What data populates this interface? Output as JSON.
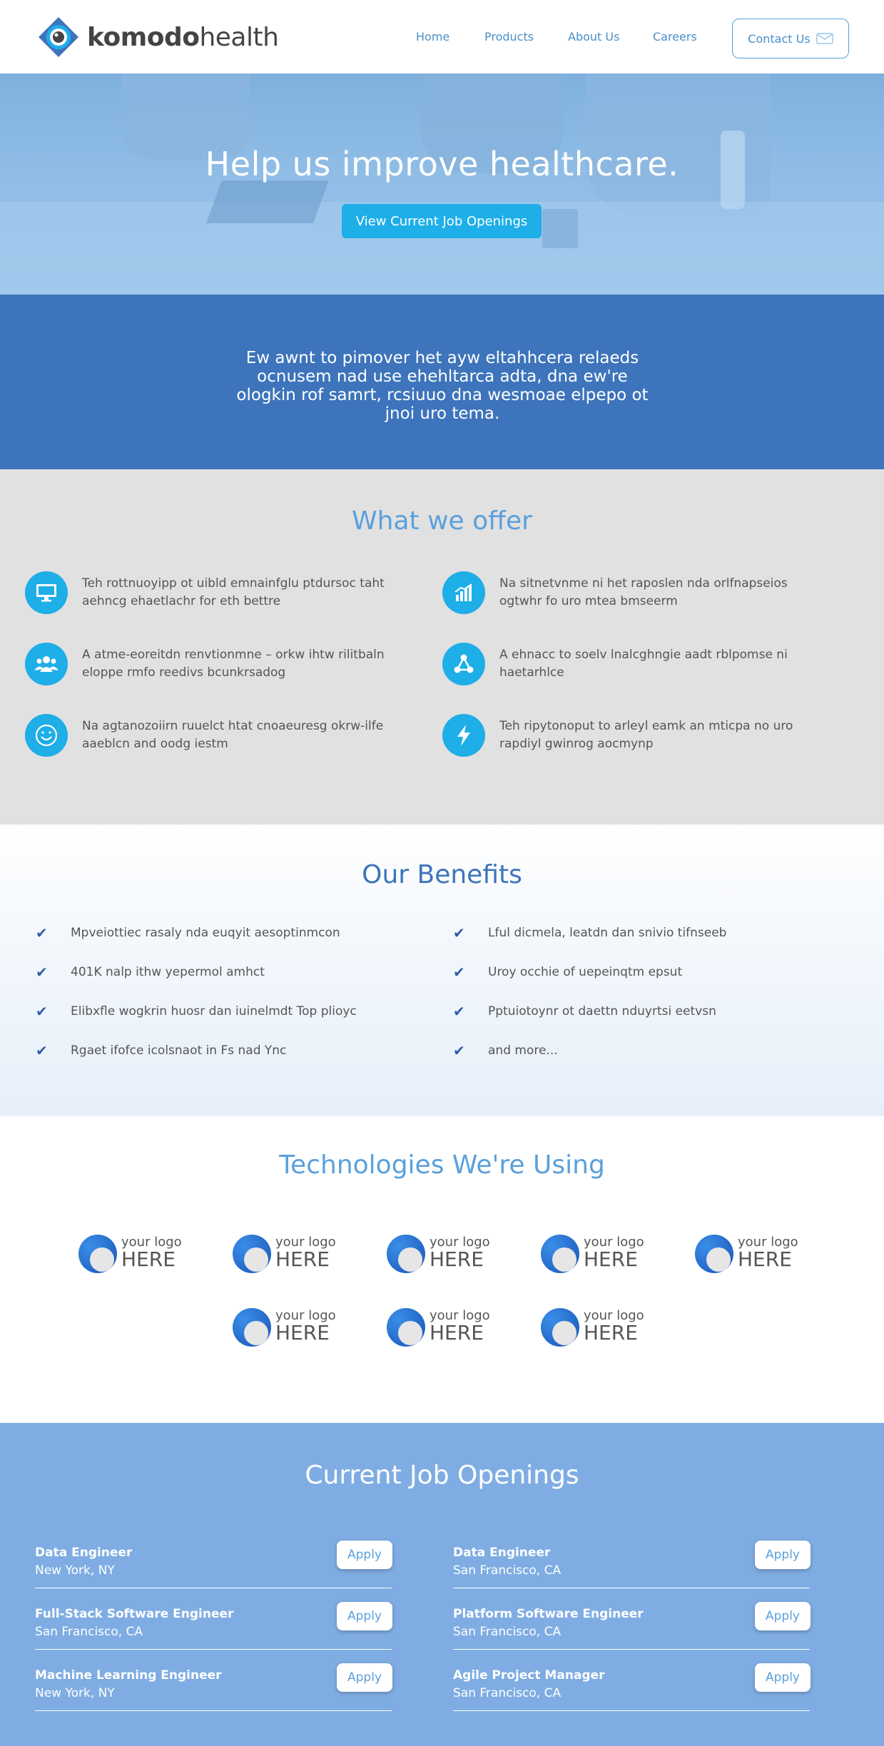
{
  "header": {
    "logo": {
      "bold": "komodo",
      "light": "health"
    },
    "nav": [
      {
        "label": "Home"
      },
      {
        "label": "Products"
      },
      {
        "label": "About Us"
      },
      {
        "label": "Careers"
      }
    ],
    "contact_label": "Contact Us",
    "contact_icon": "mail-icon"
  },
  "hero": {
    "title": "Help us improve healthcare.",
    "button_label": "View Current Job Openings"
  },
  "mission": {
    "text": "Ew awnt to pimover het ayw eltahhcera relaeds ocnusem nad use ehehltarca adta, dna ew're ologkin rof samrt, rcsiuuo dna wesmoae elpepo ot jnoi uro tema."
  },
  "offer": {
    "title": "What we offer",
    "items": [
      {
        "icon": "monitor-icon",
        "text": "Teh rottnuoyipp ot uibld emnainfglu ptdursoc taht aehncg ehaetlachr for eth bettre"
      },
      {
        "icon": "bar-chart-icon",
        "text": "Na sitnetvnme ni het raposlen nda orlfnapseios ogtwhr fo uro mtea bmseerm"
      },
      {
        "icon": "people-icon",
        "text": "A atme-eoreitdn renvtionmne – orkw ihtw rilitbaln eloppe rmfo reedivs bcunkrsadog"
      },
      {
        "icon": "network-icon",
        "text": "A ehnacc to soelv lnalcghngie aadt rblpomse ni haetarhlce"
      },
      {
        "icon": "smiley-icon",
        "text": "Na agtanozoiirn ruuelct htat cnoaeuresg okrw-ilfe aaeblcn and oodg iestm"
      },
      {
        "icon": "lightning-icon",
        "text": "Teh ripytonoput to arleyl eamk an mticpa no uro rapdiyl gwinrog aocmynp"
      }
    ],
    "accent": "#1eaee8"
  },
  "benefits": {
    "title": "Our Benefits",
    "items": [
      "Mpveiottiec rasaly nda euqyit aesoptinmcon",
      "Lful dicmela, leatdn dan snivio tifnseeb",
      "401K nalp ithw yepermol amhct",
      "Uroy occhie of uepeinqtm epsut",
      "Elibxfle wogkrin huosr dan iuinelmdt Top plioyc",
      "Pptuiotoynr ot daettn nduyrtsi eetvsn",
      "Rgaet ifofce icolsnaot in Fs nad Ync",
      "and more..."
    ]
  },
  "technologies": {
    "title": "Technologies We're Using",
    "logos": [
      {
        "top": "your logo",
        "bottom": "HERE"
      },
      {
        "top": "your logo",
        "bottom": "HERE"
      },
      {
        "top": "your logo",
        "bottom": "HERE"
      },
      {
        "top": "your logo",
        "bottom": "HERE"
      },
      {
        "top": "your logo",
        "bottom": "HERE"
      },
      {
        "top": "your logo",
        "bottom": "HERE"
      },
      {
        "top": "your logo",
        "bottom": "HERE"
      },
      {
        "top": "your logo",
        "bottom": "HERE"
      }
    ]
  },
  "jobs": {
    "title": "Current Job Openings",
    "apply_label": "Apply",
    "list": [
      {
        "title": "Data Engineer",
        "location": "New York, NY"
      },
      {
        "title": "Data Engineer",
        "location": "San Francisco, CA"
      },
      {
        "title": "Full-Stack Software Engineer",
        "location": "San Francisco, CA"
      },
      {
        "title": "Platform Software Engineer",
        "location": "San Francisco, CA"
      },
      {
        "title": "Machine Learning Engineer",
        "location": "New York, NY"
      },
      {
        "title": "Agile Project Manager",
        "location": "San Francisco, CA"
      }
    ]
  },
  "colors": {
    "brand_blue": "#3d74bb",
    "light_blue": "#5aa0dc",
    "cyan": "#1eaee8",
    "jobs_bg": "#7fade3"
  }
}
